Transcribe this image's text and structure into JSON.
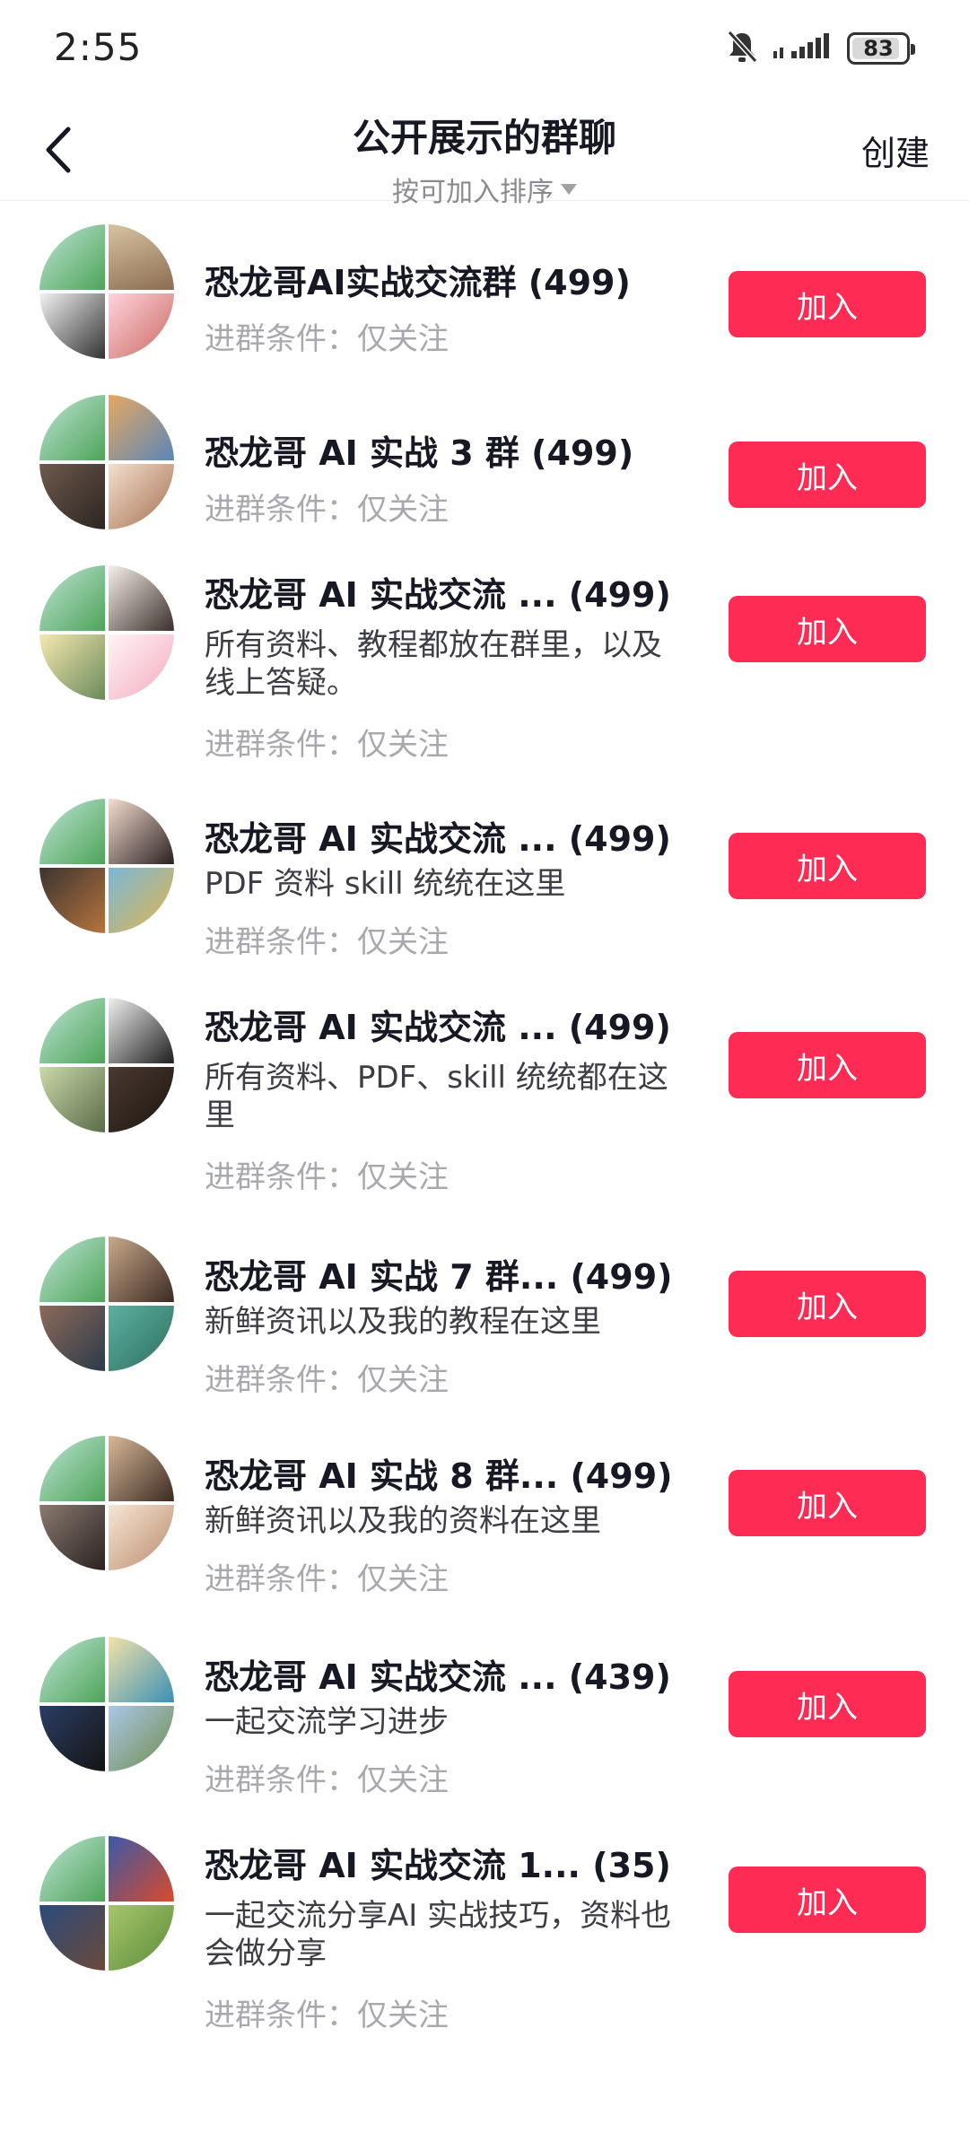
{
  "status_bar": {
    "time": "2:55",
    "battery_level": "83"
  },
  "header": {
    "title": "公开展示的群聊",
    "sort_label": "按可加入排序",
    "create_label": "创建"
  },
  "join_label": "加入",
  "condition_label": "进群条件：仅关注",
  "groups": [
    {
      "name": "恐龙哥AI实战交流群 (499)",
      "description": ""
    },
    {
      "name": "恐龙哥 AI 实战 3 群 (499)",
      "description": ""
    },
    {
      "name": "恐龙哥 AI 实战交流 ... (499)",
      "description": "所有资料、教程都放在群里，以及线上答疑。"
    },
    {
      "name": "恐龙哥 AI 实战交流 ... (499)",
      "description": "PDF 资料 skill 统统在这里"
    },
    {
      "name": "恐龙哥 AI 实战交流 ... (499)",
      "description": "所有资料、PDF、skill 统统都在这里"
    },
    {
      "name": "恐龙哥 AI 实战 7 群... (499)",
      "description": "新鲜资讯以及我的教程在这里"
    },
    {
      "name": "恐龙哥 AI 实战 8 群... (499)",
      "description": "新鲜资讯以及我的资料在这里"
    },
    {
      "name": "恐龙哥 AI 实战交流 ... (439)",
      "description": "一起交流学习进步"
    },
    {
      "name": "恐龙哥 AI 实战交流 1... (35)",
      "description": "一起交流分享AI 实战技巧，资料也会做分享"
    }
  ],
  "colors": {
    "accent": "#fe2c55",
    "text_primary": "#161823",
    "text_muted": "#a8a9ae"
  }
}
